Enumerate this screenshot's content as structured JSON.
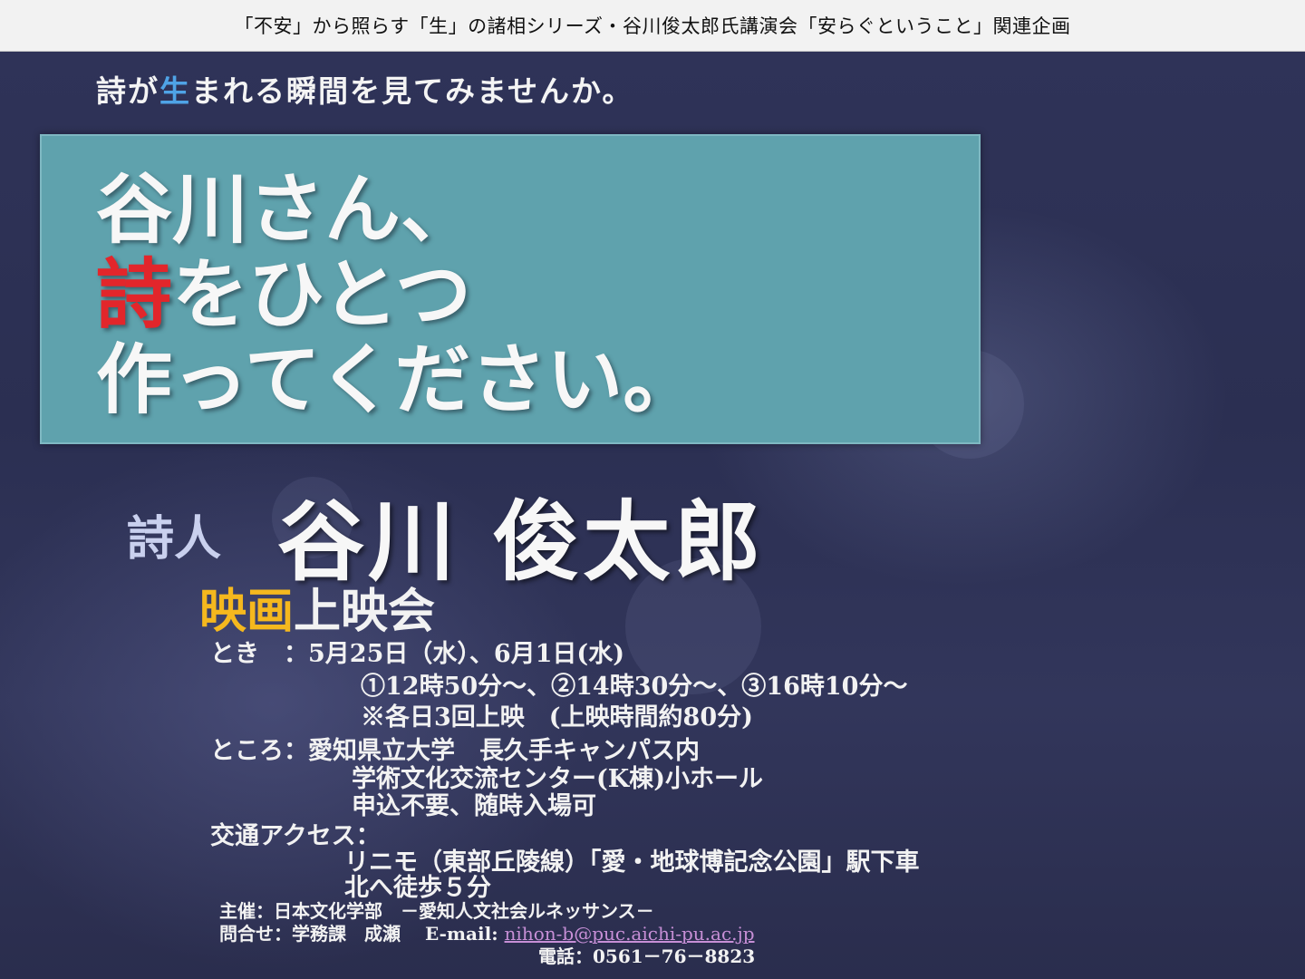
{
  "header": {
    "series_title": "「不安」から照らす「生」の諸相シリーズ・谷川俊太郎氏講演会「安らぐということ」関連企画"
  },
  "lead": {
    "before": "詩が",
    "highlight": "生",
    "after": "まれる瞬間を見てみませんか。"
  },
  "headline": {
    "line1": "谷川さん、",
    "line2_highlight": "詩",
    "line2_rest": "をひとつ",
    "line3": "作ってください。"
  },
  "poet": {
    "label": "詩人",
    "name": "谷川 俊太郎"
  },
  "screening": {
    "highlight": "映画",
    "rest": "上映会"
  },
  "details": {
    "when_label": "とき　：",
    "when_dates": "5月25日（水）、6月1日(水)",
    "when_times": "①12時50分～、②14時30分～、③16時10分～",
    "when_note": "※各日3回上映　(上映時間約80分)",
    "where_label": "ところ：",
    "where_line1": "愛知県立大学　長久手キャンパス内",
    "where_line2": "学術文化交流センター(K棟)小ホール",
    "where_line3": "申込不要、随時入場可",
    "access_label": "交通アクセス：",
    "access_line1": "リニモ（東部丘陵線）「愛・地球博記念公園」駅下車",
    "access_line2": "北へ徒歩５分"
  },
  "footer": {
    "host": "主催：日本文化学部　－愛知人文社会ルネッサンス－",
    "contact_prefix": "問合せ：学務課　成瀬　 E-mail: ",
    "email": "nihon-b@puc.aichi-pu.ac.jp",
    "phone": "電話：0561－76－8823"
  },
  "colors": {
    "background": "#2b2f52",
    "teal_box": "#5fa2ad",
    "accent_red": "#e2262b",
    "accent_blue": "#4fa3e6",
    "accent_gold": "#f5b81e"
  }
}
